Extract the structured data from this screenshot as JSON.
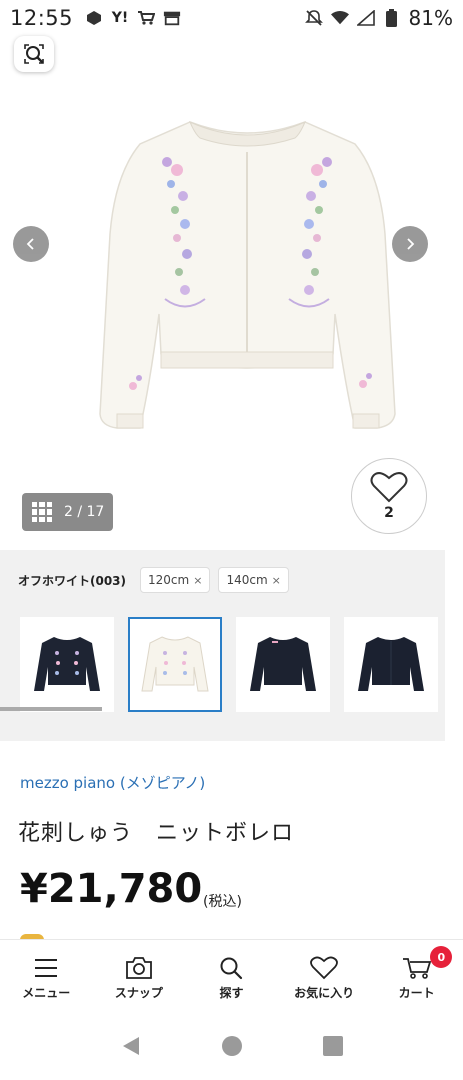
{
  "status_bar": {
    "time": "12:55",
    "battery": "81%"
  },
  "gallery": {
    "counter": "2 / 17",
    "favorite_count": "2"
  },
  "variant": {
    "color_label": "オフホワイト(003)",
    "sizes": [
      {
        "label": "120cm",
        "remove": "×"
      },
      {
        "label": "140cm",
        "remove": "×"
      }
    ]
  },
  "product": {
    "brand": "mezzo piano (メゾピアノ)",
    "name": "花刺しゅう　ニットボレロ",
    "price": "¥21,780",
    "tax_note": "(税込)"
  },
  "tabbar": {
    "items": [
      {
        "label": "メニュー",
        "icon": "menu-icon"
      },
      {
        "label": "スナップ",
        "icon": "camera-icon"
      },
      {
        "label": "探す",
        "icon": "search-icon"
      },
      {
        "label": "お気に入り",
        "icon": "heart-icon"
      },
      {
        "label": "カート",
        "icon": "cart-icon"
      }
    ],
    "cart_count": "0"
  },
  "colors": {
    "brand_link": "#2a6fb4",
    "badge_red": "#e6213a",
    "selected_border": "#2a7ec7"
  }
}
